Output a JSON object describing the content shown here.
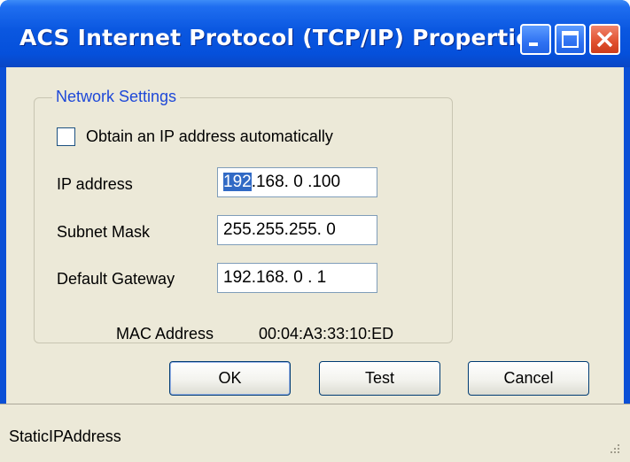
{
  "window": {
    "title": "ACS Internet Protocol (TCP/IP) Properties"
  },
  "network_settings": {
    "group_label": "Network Settings",
    "obtain_automatically": {
      "label": "Obtain an IP address automatically",
      "checked": false
    },
    "ip_address": {
      "label": "IP address",
      "value_selected": "192",
      "value_rest": ".168.  0 .100"
    },
    "subnet_mask": {
      "label": "Subnet Mask",
      "value": "255.255.255.  0"
    },
    "default_gateway": {
      "label": "Default Gateway",
      "value": "192.168.  0 .  1"
    },
    "mac_address": {
      "label": "MAC Address",
      "value": "00:04:A3:33:10:ED"
    }
  },
  "buttons": {
    "ok": "OK",
    "test": "Test",
    "cancel": "Cancel"
  },
  "status_bar": {
    "text": "StaticIPAddress"
  },
  "colors": {
    "titlebar": "#0a57e0",
    "group_label": "#1e48d8",
    "selection": "#316ac5",
    "dialog_bg": "#ece9d8"
  }
}
